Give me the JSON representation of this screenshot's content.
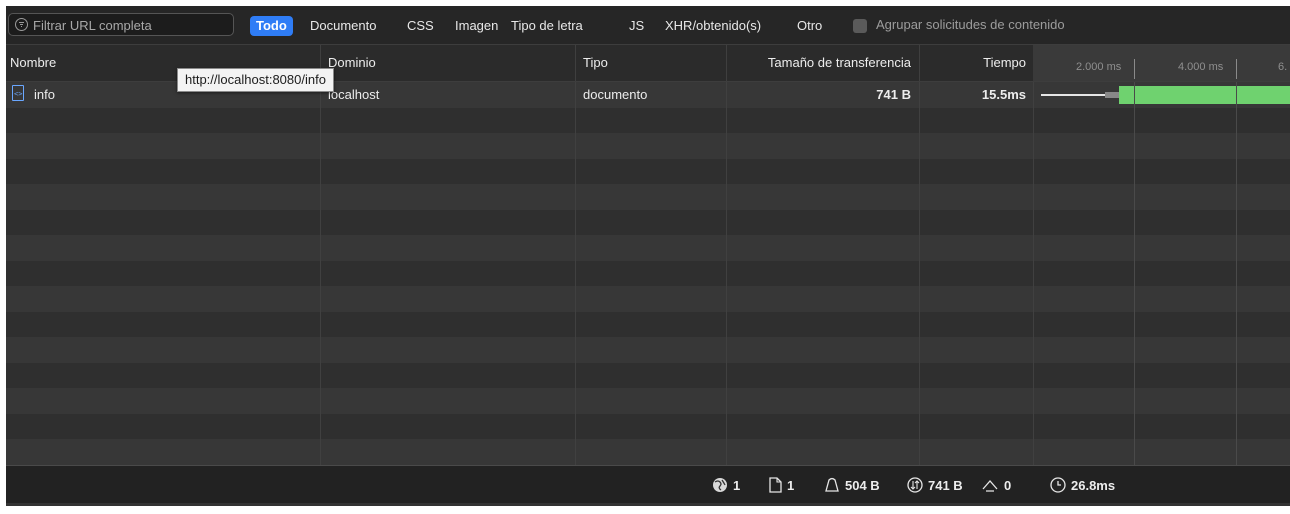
{
  "toolbar": {
    "filter_placeholder": "Filtrar URL completa",
    "tabs": [
      {
        "label": "Todo",
        "active": true
      },
      {
        "label": "Documento"
      },
      {
        "label": "CSS"
      },
      {
        "label": "Imagen"
      },
      {
        "label": "Tipo de letra"
      },
      {
        "label": "JS"
      },
      {
        "label": "XHR/obtenido(s)"
      },
      {
        "label": "Otro"
      }
    ],
    "group_label": "Agrupar solicitudes de contenido",
    "group_checked": false
  },
  "columns": {
    "name": "Nombre",
    "domain": "Dominio",
    "type": "Tipo",
    "size": "Tamaño de transferencia",
    "time": "Tiempo"
  },
  "timeline": {
    "ticks": [
      "2.000 ms",
      "4.000 ms",
      "6."
    ]
  },
  "requests": [
    {
      "name": "info",
      "domain": "localhost",
      "type": "documento",
      "size": "741 B",
      "time": "15.5ms",
      "icon": "document-code-icon"
    }
  ],
  "tooltip": "http://localhost:8080/info",
  "status": {
    "requests": "1",
    "documents": "1",
    "resources_size": "504 B",
    "transferred": "741 B",
    "redirects": "0",
    "load_time": "26.8ms"
  },
  "colors": {
    "accent": "#2f7df6",
    "waterfall_bar": "#6fd26f",
    "panel_bg": "#2a2a2a"
  }
}
